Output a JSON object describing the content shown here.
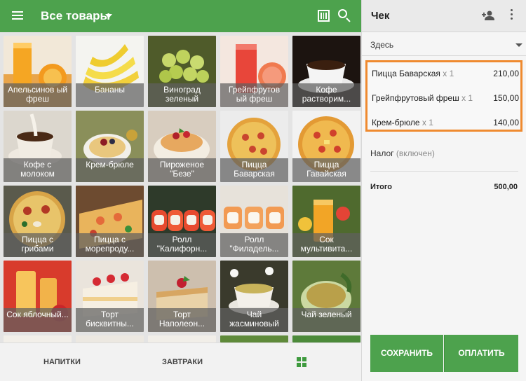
{
  "header": {
    "title": "Все товары",
    "icons": [
      "menu-icon",
      "chevron-down-icon",
      "barcode-icon",
      "search-icon"
    ],
    "color": "#4da24d"
  },
  "products": [
    {
      "label": "Апельсинов ый фреш"
    },
    {
      "label": "Бананы"
    },
    {
      "label": "Виноград зеленый"
    },
    {
      "label": "Грейпфрутов ый фреш"
    },
    {
      "label": "Кофе растворим..."
    },
    {
      "label": "Кофе с молоком"
    },
    {
      "label": "Крем-брюле"
    },
    {
      "label": "Пироженое \"Безе\""
    },
    {
      "label": "Пицца Баварская"
    },
    {
      "label": "Пицца Гавайская"
    },
    {
      "label": "Пицца с грибами"
    },
    {
      "label": "Пицца с морепроду..."
    },
    {
      "label": "Ролл \"Калифорн..."
    },
    {
      "label": "Ролл \"Филадель..."
    },
    {
      "label": "Сок мультивита..."
    },
    {
      "label": "Сок яблочный..."
    },
    {
      "label": "Торт бисквитны..."
    },
    {
      "label": "Торт Наполеон..."
    },
    {
      "label": "Чай жасминовый"
    },
    {
      "label": "Чай зеленый"
    }
  ],
  "bottom_tabs": {
    "drinks": "НАПИТКИ",
    "breakfasts": "ЗАВТРАКИ",
    "grid_icon": "grid-icon"
  },
  "receipt": {
    "title": "Чек",
    "icons": [
      "add-user-icon",
      "more-vert-icon"
    ],
    "place": "Здесь",
    "items": [
      {
        "name": "Пицца Баварская",
        "qty": "x 1",
        "price": "210,00"
      },
      {
        "name": "Грейпфрутовый фреш",
        "qty": "x 1",
        "price": "150,00"
      },
      {
        "name": "Крем-брюле",
        "qty": "x 1",
        "price": "140,00"
      }
    ],
    "tax_label": "Налог",
    "tax_note": "(включен)",
    "total_label": "Итого",
    "total_value": "500,00",
    "highlight_color": "#ef8a2f"
  },
  "actions": {
    "save": "СОХРАНИТЬ",
    "pay": "ОПЛАТИТЬ"
  }
}
